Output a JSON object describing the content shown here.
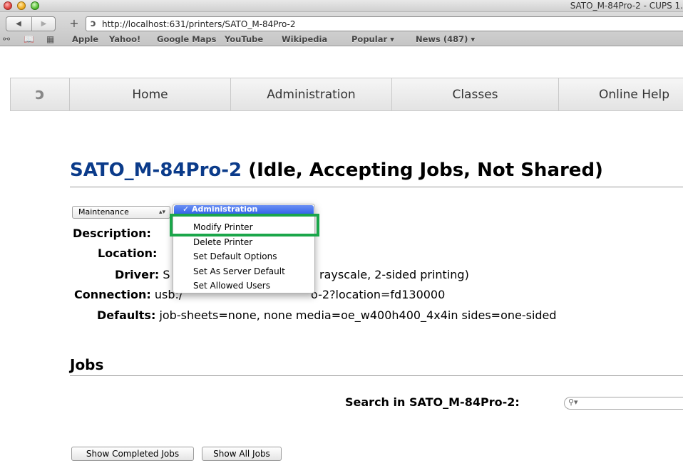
{
  "window": {
    "title": "SATO_M-84Pro-2 - CUPS 1."
  },
  "toolbar": {
    "back_icon": "◀",
    "forward_icon": "▶",
    "plus_icon": "+",
    "url": "http://localhost:631/printers/SATO_M-84Pro-2"
  },
  "bookmarks": {
    "items": [
      "Apple",
      "Yahoo!",
      "Google Maps",
      "YouTube",
      "Wikipedia",
      "Popular ▾",
      "News (487) ▾"
    ]
  },
  "cups_nav": {
    "items": [
      "Home",
      "Administration",
      "Classes",
      "Online Help"
    ]
  },
  "printer": {
    "name": "SATO_M-84Pro-2",
    "status": "(Idle, Accepting Jobs, Not Shared)",
    "action_select": "Maintenance",
    "fields": {
      "description_label": "Description:",
      "location_label": "Location:",
      "driver_label": "Driver:",
      "driver_value": "S",
      "driver_value_tail": "rayscale, 2-sided printing)",
      "connection_label": "Connection:",
      "connection_value": "usb:/",
      "connection_value_tail": "o-2?location=fd130000",
      "defaults_label": "Defaults:",
      "defaults_value": "job-sheets=none, none media=oe_w400h400_4x4in sides=one-sided"
    }
  },
  "dropdown": {
    "header": "✓ Administration",
    "items": [
      "Modify Printer",
      "Delete Printer",
      "Set Default Options",
      "Set As Server Default",
      "Set Allowed Users"
    ]
  },
  "jobs": {
    "title": "Jobs",
    "search_label": "Search in SATO_M-84Pro-2:",
    "show_completed": "Show Completed Jobs",
    "show_all": "Show All Jobs"
  },
  "colors": {
    "highlight": "#1aa64a",
    "title_link": "#0b3b8a",
    "menu_selection": "#2b5ee8"
  }
}
